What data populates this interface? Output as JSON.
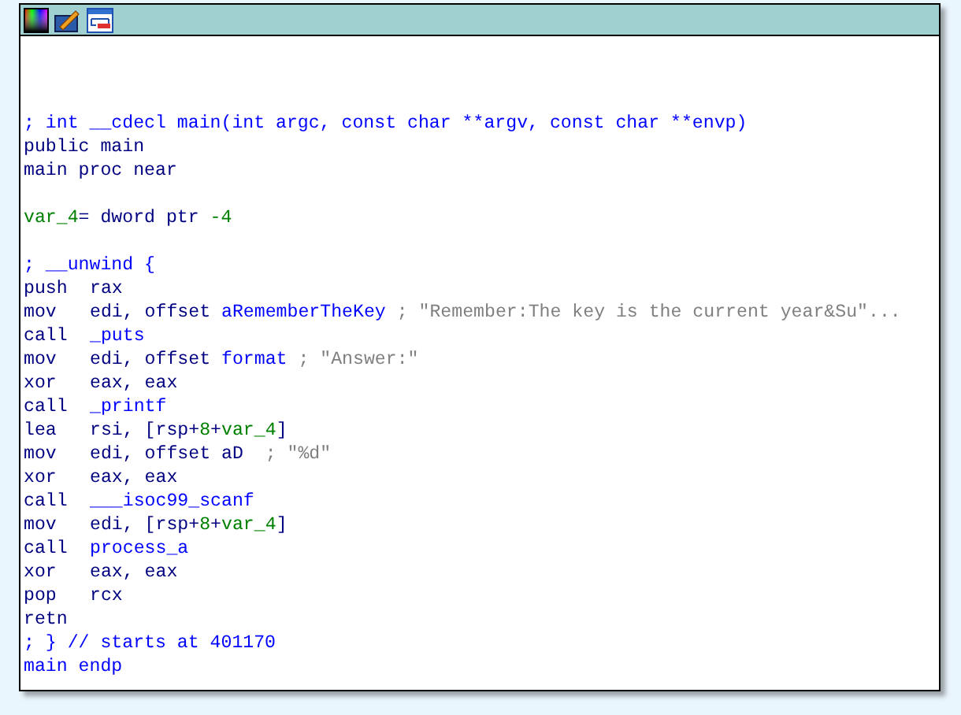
{
  "blocks": [
    [
      {
        "segments": [
          {
            "text": "; int __cdecl main(int argc, const char **argv, const char **envp)",
            "kind": "comment"
          }
        ]
      },
      {
        "segments": [
          {
            "text": "public main",
            "kind": "keyword"
          }
        ]
      },
      {
        "segments": [
          {
            "text": "main proc near",
            "kind": "keyword"
          }
        ]
      }
    ],
    [
      {
        "segments": [
          {
            "text": "var_4",
            "kind": "var"
          },
          {
            "text": "= dword ptr ",
            "kind": "keyword"
          },
          {
            "text": "-4",
            "kind": "number"
          }
        ]
      }
    ],
    [
      {
        "segments": [
          {
            "text": "; __unwind {",
            "kind": "comment"
          }
        ]
      },
      {
        "segments": [
          {
            "text": "push",
            "kind": "mnemonic"
          },
          {
            "text": "rax",
            "kind": "keyword"
          }
        ]
      },
      {
        "segments": [
          {
            "text": "mov",
            "kind": "mnemonic"
          },
          {
            "text": "edi, offset ",
            "kind": "keyword"
          },
          {
            "text": "aRememberTheKey",
            "kind": "name"
          },
          {
            "text": " ; \"Remember:The key is the current year&Su\"...",
            "kind": "string"
          }
        ]
      },
      {
        "segments": [
          {
            "text": "call",
            "kind": "mnemonic"
          },
          {
            "text": "_puts",
            "kind": "name"
          }
        ]
      },
      {
        "segments": [
          {
            "text": "mov",
            "kind": "mnemonic"
          },
          {
            "text": "edi, offset ",
            "kind": "keyword"
          },
          {
            "text": "format",
            "kind": "name"
          },
          {
            "text": " ; \"Answer:\"",
            "kind": "string"
          }
        ]
      },
      {
        "segments": [
          {
            "text": "xor",
            "kind": "mnemonic"
          },
          {
            "text": "eax, eax",
            "kind": "keyword"
          }
        ]
      },
      {
        "segments": [
          {
            "text": "call",
            "kind": "mnemonic"
          },
          {
            "text": "_printf",
            "kind": "name"
          }
        ]
      },
      {
        "segments": [
          {
            "text": "lea",
            "kind": "mnemonic"
          },
          {
            "text": "rsi, [rsp+",
            "kind": "keyword"
          },
          {
            "text": "8",
            "kind": "number"
          },
          {
            "text": "+",
            "kind": "keyword"
          },
          {
            "text": "var_4",
            "kind": "var"
          },
          {
            "text": "]",
            "kind": "keyword"
          }
        ]
      },
      {
        "segments": [
          {
            "text": "mov",
            "kind": "mnemonic"
          },
          {
            "text": "edi, offset aD",
            "kind": "keyword"
          },
          {
            "text": "  ; \"%d\"",
            "kind": "string"
          }
        ]
      },
      {
        "segments": [
          {
            "text": "xor",
            "kind": "mnemonic"
          },
          {
            "text": "eax, eax",
            "kind": "keyword"
          }
        ]
      },
      {
        "segments": [
          {
            "text": "call",
            "kind": "mnemonic"
          },
          {
            "text": "___isoc99_scanf",
            "kind": "name"
          }
        ]
      },
      {
        "segments": [
          {
            "text": "mov",
            "kind": "mnemonic"
          },
          {
            "text": "edi, [rsp+",
            "kind": "keyword"
          },
          {
            "text": "8",
            "kind": "number"
          },
          {
            "text": "+",
            "kind": "keyword"
          },
          {
            "text": "var_4",
            "kind": "var"
          },
          {
            "text": "]",
            "kind": "keyword"
          }
        ]
      },
      {
        "segments": [
          {
            "text": "call",
            "kind": "mnemonic"
          },
          {
            "text": "process_a",
            "kind": "name"
          }
        ]
      },
      {
        "segments": [
          {
            "text": "xor",
            "kind": "mnemonic"
          },
          {
            "text": "eax, eax",
            "kind": "keyword"
          }
        ]
      },
      {
        "segments": [
          {
            "text": "pop",
            "kind": "mnemonic"
          },
          {
            "text": "rcx",
            "kind": "keyword"
          }
        ]
      },
      {
        "segments": [
          {
            "text": "retn",
            "kind": "mnemonic"
          }
        ]
      },
      {
        "segments": [
          {
            "text": "; } // starts at 401170",
            "kind": "comment"
          }
        ]
      },
      {
        "segments": [
          {
            "text": "main endp",
            "kind": "comment"
          }
        ]
      }
    ]
  ]
}
